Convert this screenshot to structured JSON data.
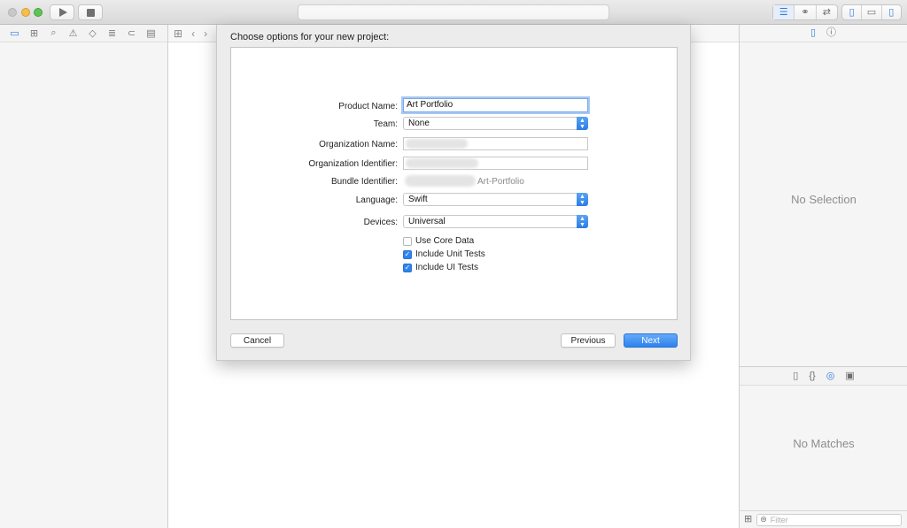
{
  "toolbar": {
    "editor_icons": [
      "align-left-icon",
      "link-rings-icon",
      "back-forth-arrows-icon"
    ],
    "view_icons": [
      "navigator-panel-icon",
      "debug-panel-icon",
      "inspector-panel-icon"
    ]
  },
  "navigator": {
    "tabs": [
      "folder-icon",
      "hierarchy-icon",
      "search-icon",
      "warning-icon",
      "diamond-icon",
      "list-icon",
      "tag-icon",
      "speech-bubble-icon"
    ]
  },
  "inspector": {
    "no_selection": "No Selection",
    "no_matches": "No Matches",
    "filter_placeholder": "Filter"
  },
  "dialog": {
    "title": "Choose options for your new project:",
    "product_name_label": "Product Name:",
    "product_name_value": "Art Portfolio",
    "team_label": "Team:",
    "team_value": "None",
    "org_name_label": "Organization Name:",
    "org_name_value": "",
    "org_id_label": "Organization Identifier:",
    "org_id_value": "",
    "bundle_label": "Bundle Identifier:",
    "bundle_value": "Art-Portfolio",
    "language_label": "Language:",
    "language_value": "Swift",
    "devices_label": "Devices:",
    "devices_value": "Universal",
    "options": [
      {
        "label": "Use Core Data",
        "checked": false
      },
      {
        "label": "Include Unit Tests",
        "checked": true
      },
      {
        "label": "Include UI Tests",
        "checked": true
      }
    ],
    "cancel_label": "Cancel",
    "previous_label": "Previous",
    "next_label": "Next"
  },
  "colors": {
    "accent": "#2f84ee",
    "window_bg": "#ececec"
  }
}
